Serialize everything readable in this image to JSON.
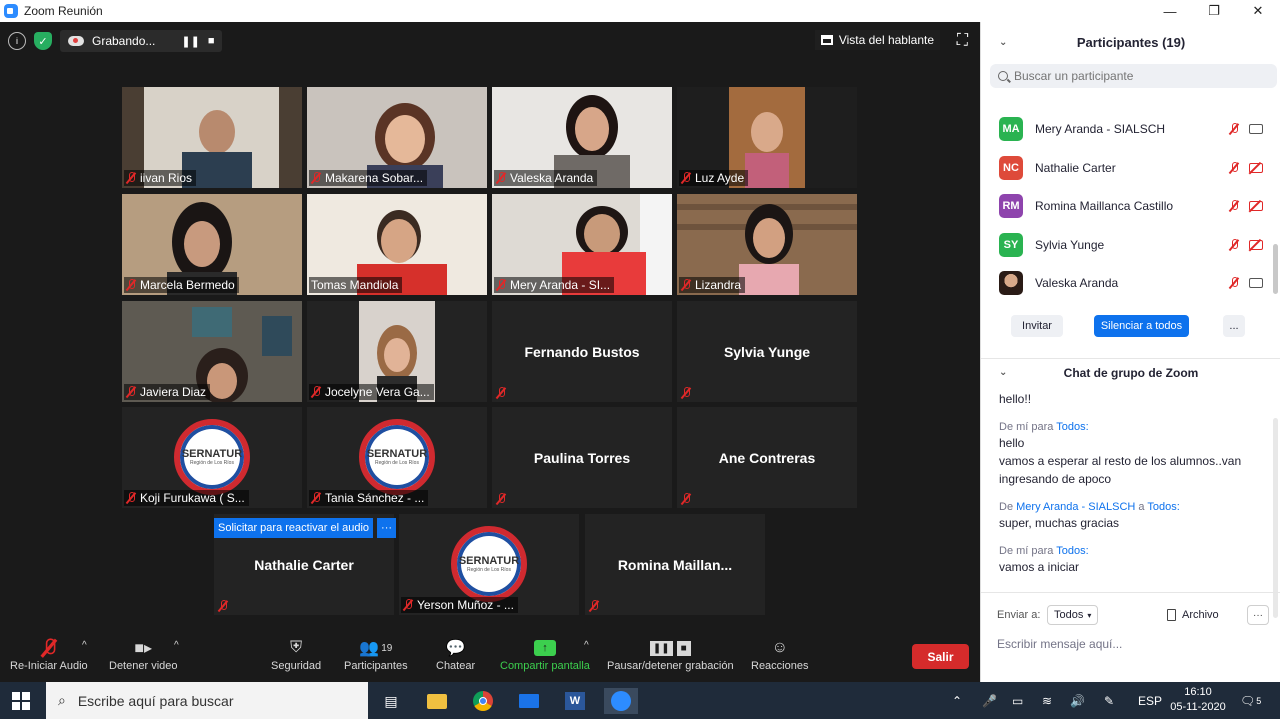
{
  "window": {
    "title": "Zoom Reunión"
  },
  "topbar": {
    "recording_label": "Grabando...",
    "speaker_view_label": "Vista del hablante"
  },
  "tiles": [
    {
      "name": "iivan Rios",
      "video": true
    },
    {
      "name": "Makarena Sobar...",
      "video": true
    },
    {
      "name": "Valeska Aranda",
      "video": true
    },
    {
      "name": "Luz Ayde",
      "video": true
    },
    {
      "name": "Marcela Bermedo",
      "video": true
    },
    {
      "name": "Tomas Mandiola",
      "video": true
    },
    {
      "name": "Mery Aranda - SI...",
      "video": true
    },
    {
      "name": "Lizandra",
      "video": true
    },
    {
      "name": "Javiera Diaz",
      "video": true
    },
    {
      "name": "Jocelyne Vera Ga...",
      "video": true
    },
    {
      "display": "Fernando Bustos"
    },
    {
      "display": "Sylvia Yunge"
    },
    {
      "name": "Koji Furukawa ( S...",
      "logo": true
    },
    {
      "name": "Tania Sánchez - ...",
      "logo": true
    },
    {
      "display": "Paulina Torres"
    },
    {
      "display": "Ane Contreras"
    },
    {
      "display": "Nathalie Carter"
    },
    {
      "name": "Yerson Muñoz - ...",
      "logo": true
    },
    {
      "display": "Romina  Maillan..."
    }
  ],
  "logo": {
    "title": "SERNATUR",
    "subtitle": "Región de Los Ríos"
  },
  "reactivate": {
    "label": "Solicitar para reactivar el audio",
    "more": "···"
  },
  "toolbar": {
    "audio": "Re-Iniciar Audio",
    "video": "Detener video",
    "security": "Seguridad",
    "participants": "Participantes",
    "participants_count": "19",
    "chat": "Chatear",
    "share": "Compartir pantalla",
    "record": "Pausar/detener grabación",
    "reactions": "Reacciones",
    "leave": "Salir"
  },
  "participants_panel": {
    "title": "Participantes (19)",
    "search_placeholder": "Buscar un participante",
    "list": [
      {
        "initials": "MA",
        "name": "Mery Aranda - SIALSCH",
        "color": "#2ab351",
        "video_on": true
      },
      {
        "initials": "NC",
        "name": "Nathalie Carter",
        "color": "#de4a3a",
        "video_on": false
      },
      {
        "initials": "RM",
        "name": "Romina Maillanca Castillo",
        "color": "#8e44ad",
        "video_on": false
      },
      {
        "initials": "SY",
        "name": "Sylvia Yunge",
        "color": "#2ab351",
        "video_on": false
      },
      {
        "initials": "",
        "name": "Valeska Aranda",
        "color": "#6b4b3e",
        "video_on": true
      }
    ],
    "invite": "Invitar",
    "mute_all": "Silenciar a todos",
    "more": "..."
  },
  "chat": {
    "title": "Chat de grupo de Zoom",
    "messages": [
      {
        "from": "",
        "to": "",
        "lines": [
          "hello!!"
        ]
      },
      {
        "from": "De mí para",
        "to": "Todos:",
        "lines": [
          "hello",
          "vamos a esperar al resto de los alumnos..van ingresando de apoco"
        ]
      },
      {
        "from": "De",
        "sender": "Mery Aranda - SIALSCH",
        "mid": "a",
        "to": "Todos:",
        "lines": [
          "super, muchas gracias"
        ]
      },
      {
        "from": "De mí para",
        "to": "Todos:",
        "lines": [
          "vamos a iniciar"
        ]
      }
    ],
    "send_to_label": "Enviar a:",
    "send_to_value": "Todos",
    "file_label": "Archivo",
    "more": "···",
    "input_placeholder": "Escribir mensaje aquí..."
  },
  "taskbar": {
    "search_placeholder": "Escribe aquí para buscar",
    "language": "ESP",
    "time": "16:10",
    "date": "05-11-2020",
    "notifications": "5"
  }
}
